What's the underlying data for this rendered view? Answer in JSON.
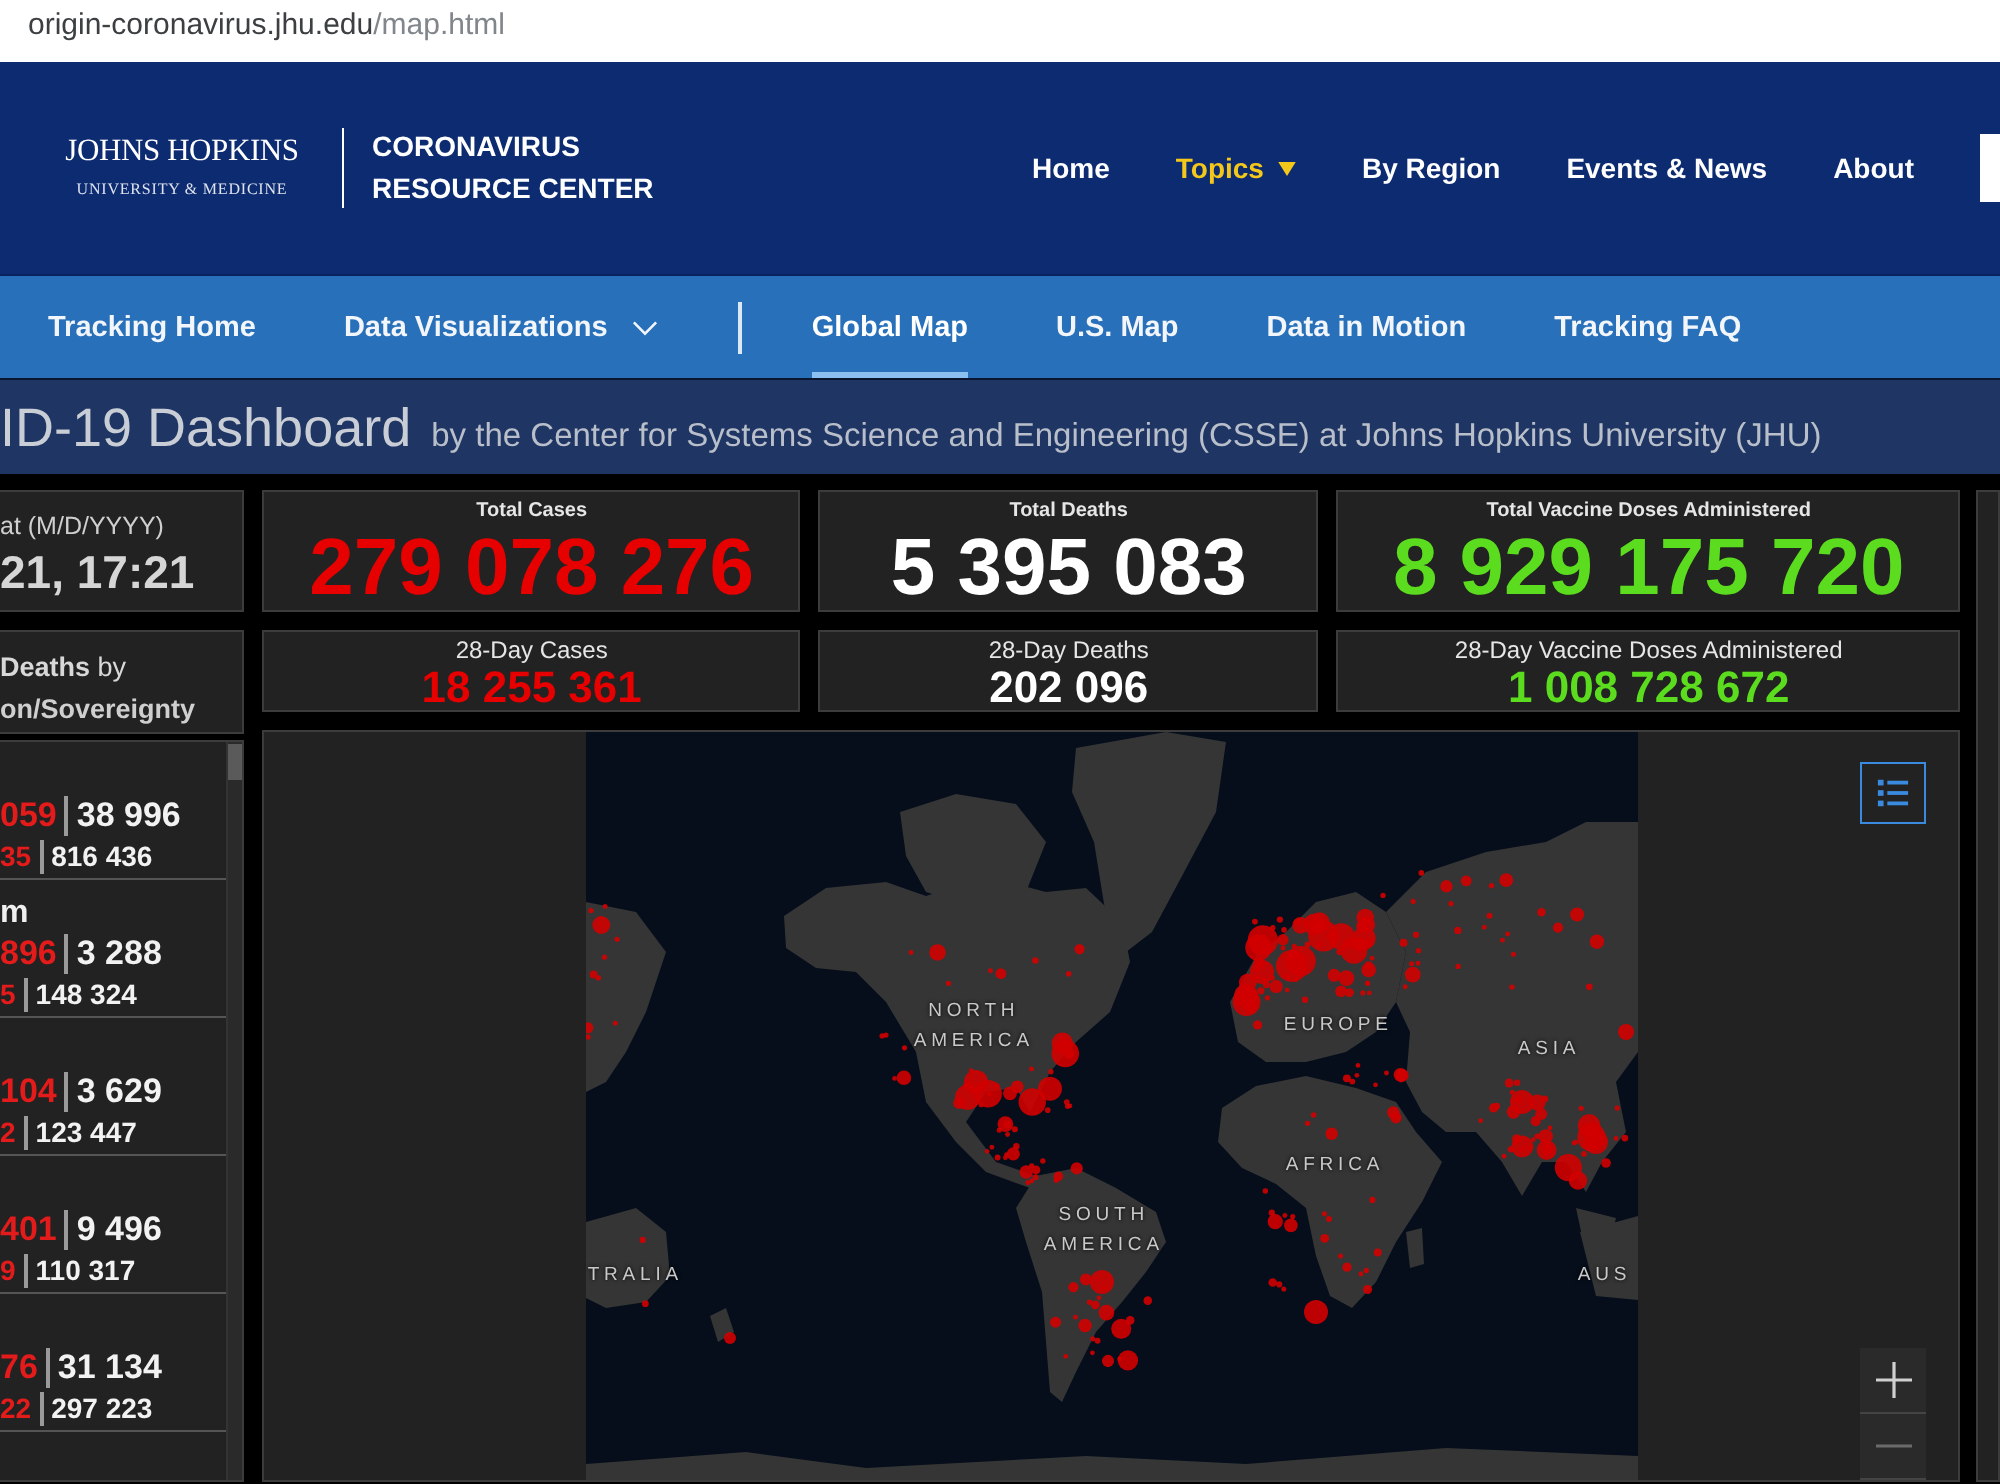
{
  "browser": {
    "url_host": "origin-coronavirus.jhu.edu",
    "url_path": "/map.html"
  },
  "header": {
    "logo": {
      "name": "JOHNS HOPKINS",
      "subtitle": "UNIVERSITY & MEDICINE"
    },
    "site_title": "CORONAVIRUS RESOURCE CENTER",
    "nav": [
      {
        "label": "Home",
        "selected": false,
        "dropdown": false
      },
      {
        "label": "Topics",
        "selected": true,
        "dropdown": true
      },
      {
        "label": "By Region",
        "selected": false,
        "dropdown": false
      },
      {
        "label": "Events & News",
        "selected": false,
        "dropdown": false
      },
      {
        "label": "About",
        "selected": false,
        "dropdown": false
      }
    ]
  },
  "sub_nav": {
    "groups": [
      [
        {
          "label": "Tracking Home",
          "selected": false,
          "dropdown": false
        },
        {
          "label": "Data Visualizations",
          "selected": false,
          "dropdown": true
        }
      ],
      [
        {
          "label": "Global Map",
          "selected": true,
          "dropdown": false
        },
        {
          "label": "U.S. Map",
          "selected": false,
          "dropdown": false
        },
        {
          "label": "Data in Motion",
          "selected": false,
          "dropdown": false
        },
        {
          "label": "Tracking FAQ",
          "selected": false,
          "dropdown": false
        }
      ]
    ]
  },
  "dashboard_title": {
    "title": "ID-19 Dashboard",
    "byline": "by the Center for Systems Science and Engineering (CSSE) at Johns Hopkins University (JHU)"
  },
  "last_updated": {
    "label": "at (M/D/YYYY)",
    "value": "21, 17:21"
  },
  "deaths_list": {
    "heading_lines": [
      "**Deaths** by",
      "on/Sovereignty"
    ],
    "rows": [
      {
        "line_1": {
          "value_1": "059",
          "value_2": "38 996"
        },
        "line_2": {
          "value_1": "35",
          "value_2": "816 436"
        }
      },
      {
        "name": "m",
        "line_1": {
          "value_1": "896",
          "value_2": "3 288"
        },
        "line_2": {
          "value_1": "5",
          "value_2": "148 324"
        }
      },
      {
        "line_1": {
          "value_1": "104",
          "value_2": "3 629"
        },
        "line_2": {
          "value_1": "2",
          "value_2": "123 447"
        }
      },
      {
        "line_1": {
          "value_1": "401",
          "value_2": "9 496"
        },
        "line_2": {
          "value_1": "9",
          "value_2": "110 317"
        }
      },
      {
        "line_1": {
          "value_1": "76",
          "value_2": "31 134"
        },
        "line_2": {
          "value_1": "22",
          "value_2": "297 223"
        }
      }
    ]
  },
  "totals": [
    {
      "label": "Total Cases",
      "value": "279 078 276",
      "color": "#e60000"
    },
    {
      "label": "Total Deaths",
      "value": "5 395 083",
      "color": "#ffffff"
    },
    {
      "label": "Total Vaccine Doses Administered",
      "value": "8 929 175 720",
      "color": "#5bdc1e"
    }
  ],
  "day_28": [
    {
      "label": "28-Day Cases",
      "value": "18 255 361",
      "color": "#e60000"
    },
    {
      "label": "28-Day Deaths",
      "value": "202 096",
      "color": "#ffffff"
    },
    {
      "label": "28-Day Vaccine Doses Administered",
      "value": "1 008 728 672",
      "color": "#5bdc1e"
    }
  ],
  "map": {
    "labels": [
      "NORTH AMERICA",
      "EUROPE",
      "ASIA",
      "AFRICA",
      "SOUTH AMERICA",
      "TRALIA",
      "AUS"
    ]
  }
}
